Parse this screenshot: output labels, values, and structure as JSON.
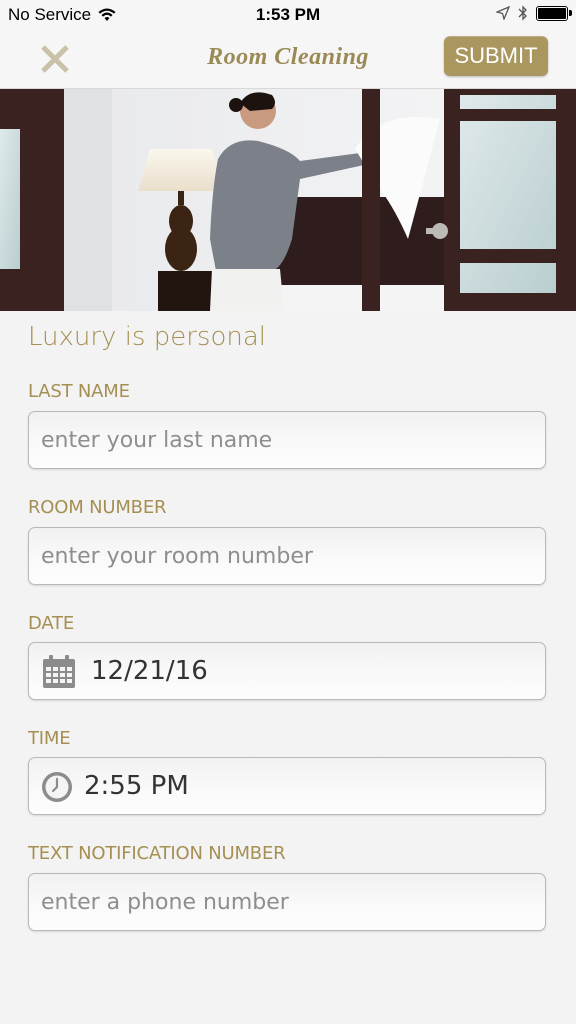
{
  "status_bar": {
    "carrier": "No Service",
    "time": "1:53 PM"
  },
  "nav": {
    "title": "Room Cleaning",
    "submit_label": "SUBMIT"
  },
  "colors": {
    "accent": "#a58f52",
    "button": "#a9975f",
    "background": "#f3f3f3"
  },
  "form": {
    "tagline": "Luxury is personal",
    "last_name": {
      "label": "LAST NAME",
      "placeholder": "enter your last name",
      "value": ""
    },
    "room_number": {
      "label": "ROOM NUMBER",
      "placeholder": "enter your room number",
      "value": ""
    },
    "date": {
      "label": "DATE",
      "value": "12/21/16",
      "icon": "calendar-icon"
    },
    "time": {
      "label": "TIME",
      "value": "2:55 PM",
      "icon": "clock-icon"
    },
    "phone": {
      "label": "TEXT NOTIFICATION NUMBER",
      "placeholder": "enter a phone number",
      "value": ""
    }
  }
}
